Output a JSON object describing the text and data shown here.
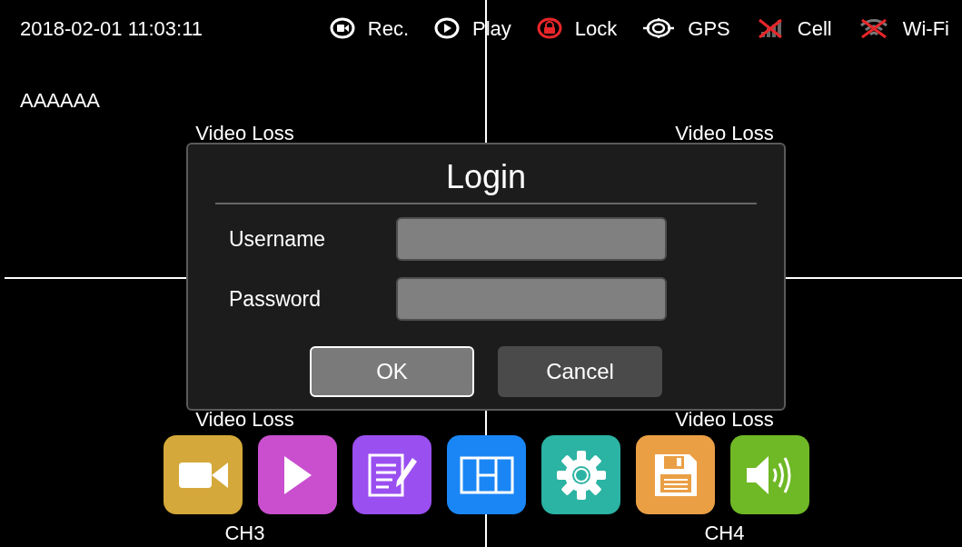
{
  "status_bar": {
    "datetime": "2018-02-01 11:03:11",
    "items": [
      {
        "kind": "rec",
        "label": "Rec.",
        "alert": false
      },
      {
        "kind": "play",
        "label": "Play",
        "alert": false
      },
      {
        "kind": "lock",
        "label": "Lock",
        "alert": true
      },
      {
        "kind": "gps",
        "label": "GPS",
        "alert": false
      },
      {
        "kind": "cell",
        "label": "Cell",
        "alert": true
      },
      {
        "kind": "wifi",
        "label": "Wi-Fi",
        "alert": true
      }
    ]
  },
  "channels": [
    {
      "title": "AAAAAA",
      "message": "Video Loss"
    },
    {
      "message": "Video Loss"
    },
    {
      "message": "Video Loss",
      "label": "CH3"
    },
    {
      "message": "Video Loss",
      "label": "CH4"
    }
  ],
  "login_dialog": {
    "title": "Login",
    "fields": [
      {
        "label": "Username"
      },
      {
        "label": "Password"
      }
    ],
    "buttons": [
      {
        "label": "OK",
        "selected": true
      },
      {
        "label": "Cancel",
        "selected": false
      }
    ]
  },
  "dock": [
    {
      "kind": "record",
      "color": "#d4a83a"
    },
    {
      "kind": "play",
      "color": "#c94fcf"
    },
    {
      "kind": "log",
      "color": "#9a4ff0"
    },
    {
      "kind": "layout",
      "color": "#1a86f5"
    },
    {
      "kind": "settings",
      "color": "#2bb3a3"
    },
    {
      "kind": "storage",
      "color": "#ea9f45"
    },
    {
      "kind": "volume",
      "color": "#6fb826"
    }
  ]
}
